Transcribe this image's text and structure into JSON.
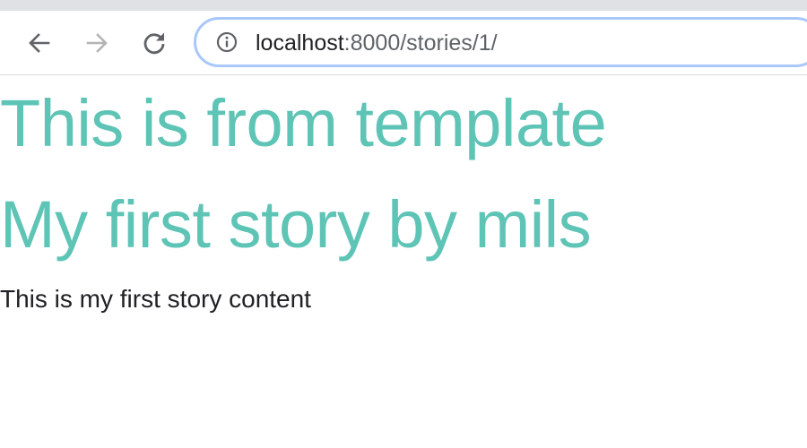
{
  "browser": {
    "url_host": "localhost",
    "url_path": ":8000/stories/1/",
    "icons": {
      "back": "back-arrow-icon",
      "forward": "forward-arrow-icon",
      "reload": "reload-icon",
      "info": "info-icon"
    },
    "colors": {
      "omnibox_border": "#a8c7fa",
      "toolbar_icon": "#5f6368",
      "forward_disabled": "#b4b4b4"
    }
  },
  "page": {
    "template_heading": "This is from template",
    "story_title": "My first story by mils",
    "story_content": "This is my first story content",
    "colors": {
      "heading": "#5ec4b6",
      "body_text": "#202124"
    }
  }
}
